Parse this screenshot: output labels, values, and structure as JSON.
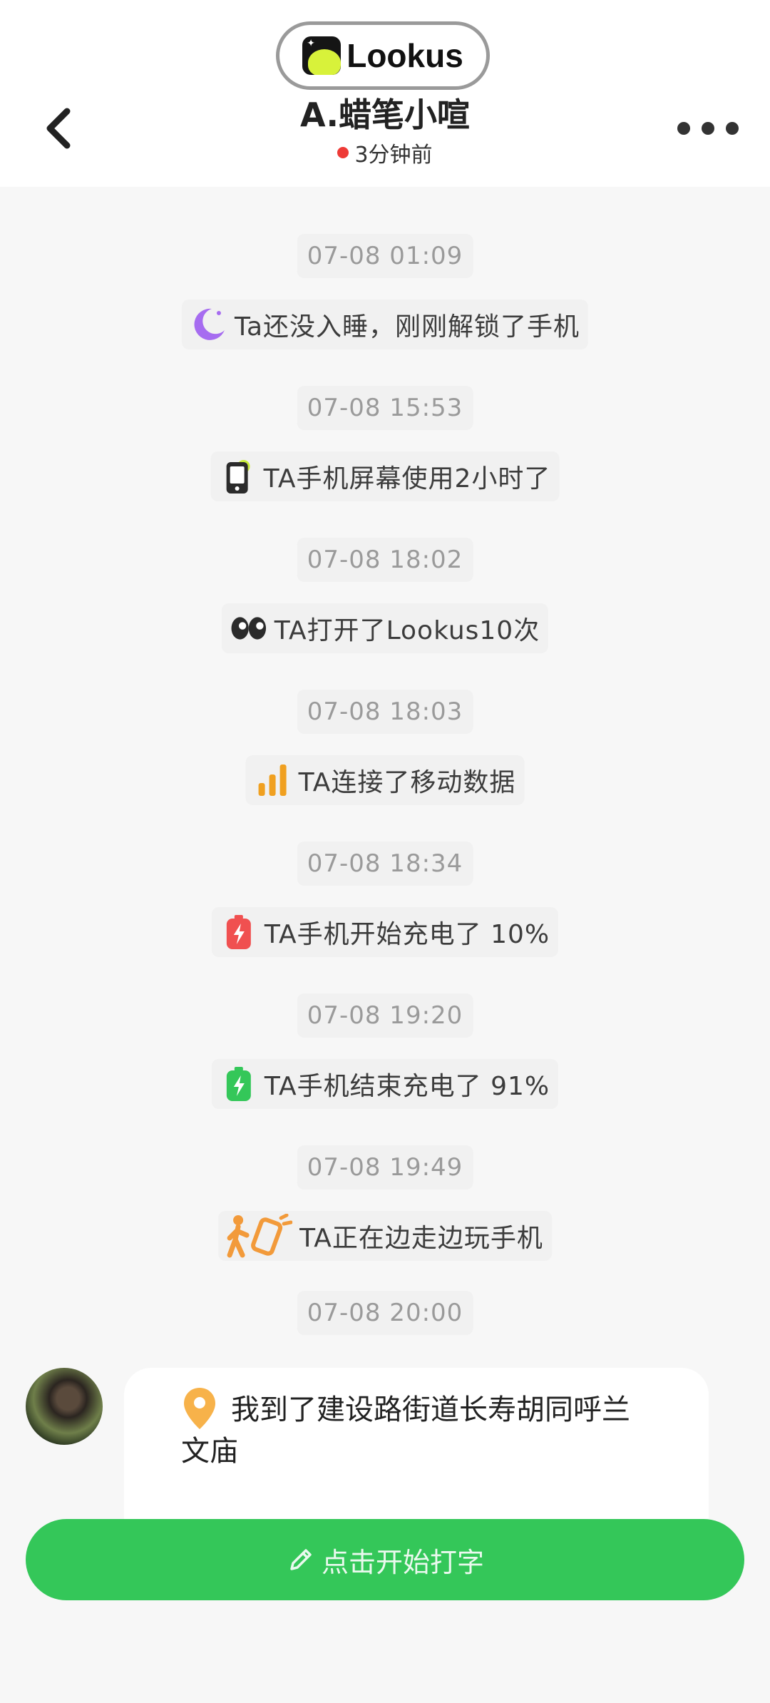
{
  "app": {
    "name": "Lookus"
  },
  "header": {
    "title": "A.蜡笔小喧",
    "status": "3分钟前"
  },
  "timeline": [
    {
      "time": "07-08 01:09",
      "icon": "moon-icon",
      "text": "Ta还没入睡，刚刚解锁了手机"
    },
    {
      "time": "07-08 15:53",
      "icon": "phone-screen-icon",
      "text": "TA手机屏幕使用2小时了"
    },
    {
      "time": "07-08 18:02",
      "icon": "eyes-icon",
      "text": "TA打开了Lookus10次"
    },
    {
      "time": "07-08 18:03",
      "icon": "signal-bars-icon",
      "text": "TA连接了移动数据"
    },
    {
      "time": "07-08 18:34",
      "icon": "battery-charging-red-icon",
      "text": "TA手机开始充电了 10%"
    },
    {
      "time": "07-08 19:20",
      "icon": "battery-charging-green-icon",
      "text": "TA手机结束充电了 91%"
    },
    {
      "time": "07-08 19:49",
      "icon": "walking-phone-icon",
      "text": "TA正在边走边玩手机"
    }
  ],
  "last_time": "07-08 20:00",
  "message": {
    "icon": "location-pin-icon",
    "text": "我到了建设路街道长寿胡同呼兰文庙"
  },
  "input_button": {
    "label": "点击开始打字",
    "icon": "pencil-icon"
  },
  "colors": {
    "accent": "#34c759",
    "status_dot": "#ee3a36",
    "moon": "#a66cf0",
    "signal": "#f0a020",
    "battery_red": "#f05050",
    "battery_green": "#34c759",
    "walker": "#f29a3a",
    "pin": "#f7b24a"
  }
}
